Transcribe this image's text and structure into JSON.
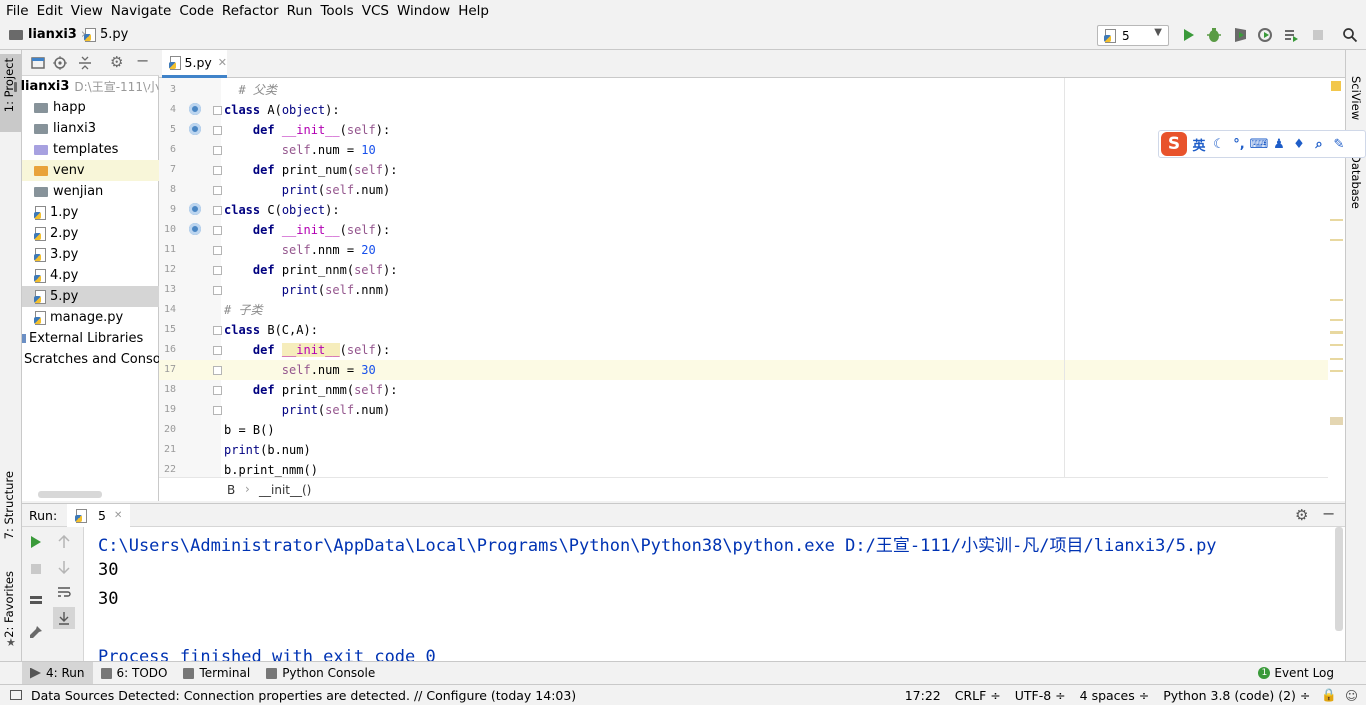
{
  "menu": [
    "File",
    "Edit",
    "View",
    "Navigate",
    "Code",
    "Refactor",
    "Run",
    "Tools",
    "VCS",
    "Window",
    "Help"
  ],
  "nav": {
    "project": "lianxi3",
    "file": "5.py"
  },
  "run_config": {
    "selected": "5"
  },
  "left_tabs": {
    "project": "1: Project",
    "structure": "7: Structure",
    "favorites": "2: Favorites"
  },
  "right_tabs": {
    "sciview": "SciView",
    "database": "Database"
  },
  "project_tree": {
    "root_name": "lianxi3",
    "root_path": "D:\\王宣-111\\小",
    "items": [
      {
        "label": "happ",
        "kind": "folder"
      },
      {
        "label": "lianxi3",
        "kind": "folder"
      },
      {
        "label": "templates",
        "kind": "folder-purple"
      },
      {
        "label": "venv",
        "kind": "folder-orange"
      },
      {
        "label": "wenjian",
        "kind": "folder"
      },
      {
        "label": "1.py",
        "kind": "py"
      },
      {
        "label": "2.py",
        "kind": "py"
      },
      {
        "label": "3.py",
        "kind": "py"
      },
      {
        "label": "4.py",
        "kind": "py"
      },
      {
        "label": "5.py",
        "kind": "py",
        "selected": true
      },
      {
        "label": "manage.py",
        "kind": "py"
      }
    ],
    "external": "External Libraries",
    "scratches": "Scratches and Console"
  },
  "editor": {
    "tab_label": "5.py",
    "current_line": 17,
    "lines": [
      {
        "n": 3,
        "html": "  <span class=\"cmt\"># 父类</span>"
      },
      {
        "n": 4,
        "html": "<span class=\"kw\">class</span> A(<span class=\"bi\">object</span>):"
      },
      {
        "n": 5,
        "html": "    <span class=\"kw\">def</span> <span class=\"dunder\">__init__</span>(<span class=\"slf\">self</span>):"
      },
      {
        "n": 6,
        "html": "        <span class=\"slf\">self</span>.num = <span class=\"num\">10</span>"
      },
      {
        "n": 7,
        "html": "    <span class=\"kw\">def</span> print_num(<span class=\"slf\">self</span>):"
      },
      {
        "n": 8,
        "html": "        <span class=\"bi\">print</span>(<span class=\"slf\">self</span>.num)"
      },
      {
        "n": 9,
        "html": "<span class=\"kw\">class</span> C(<span class=\"bi\">object</span>):"
      },
      {
        "n": 10,
        "html": "    <span class=\"kw\">def</span> <span class=\"dunder\">__init__</span>(<span class=\"slf\">self</span>):"
      },
      {
        "n": 11,
        "html": "        <span class=\"slf\">self</span>.nnm = <span class=\"num\">20</span>"
      },
      {
        "n": 12,
        "html": "    <span class=\"kw\">def</span> print_nnm(<span class=\"slf\">self</span>):"
      },
      {
        "n": 13,
        "html": "        <span class=\"bi\">print</span>(<span class=\"slf\">self</span>.nnm)"
      },
      {
        "n": 14,
        "html": "<span class=\"cmt\"># 子类</span>"
      },
      {
        "n": 15,
        "html": "<span class=\"kw\">class</span> B(C,A):"
      },
      {
        "n": 16,
        "html": "    <span class=\"kw\">def</span> <span class=\"dunder hl\">__init__</span>(<span class=\"slf\">self</span>):"
      },
      {
        "n": 17,
        "html": "        <span class=\"slf\">self</span>.num = <span class=\"num\">30</span>"
      },
      {
        "n": 18,
        "html": "    <span class=\"kw\">def</span> print_nmm(<span class=\"slf\">self</span>):"
      },
      {
        "n": 19,
        "html": "        <span class=\"bi\">print</span>(<span class=\"slf\">self</span>.num)"
      },
      {
        "n": 20,
        "html": "b = B()"
      },
      {
        "n": 21,
        "html": "<span class=\"bi\">print</span>(b.num)"
      },
      {
        "n": 22,
        "html": "b.print_nmm()"
      }
    ],
    "breadcrumb": [
      "B",
      "__init__()"
    ]
  },
  "run_panel": {
    "label": "Run:",
    "tab": "5",
    "output": [
      "C:\\Users\\Administrator\\AppData\\Local\\Programs\\Python\\Python38\\python.exe D:/王宣-111/小实训-凡/项目/lianxi3/5.py",
      "30",
      "30",
      "",
      "Process finished with exit code 0"
    ]
  },
  "bottom_tabs": [
    {
      "label": "4: Run",
      "icon": "run-icon",
      "active": true
    },
    {
      "label": "6: TODO",
      "icon": "todo-icon"
    },
    {
      "label": "Terminal",
      "icon": "terminal-icon"
    },
    {
      "label": "Python Console",
      "icon": "python-console-icon"
    }
  ],
  "event_log": "Event Log",
  "event_log_badge": "1",
  "status": {
    "message": "Data Sources Detected: Connection properties are detected. // Configure (today 14:03)",
    "position": "17:22",
    "line_sep": "CRLF ÷",
    "encoding": "UTF-8 ÷",
    "indent": "4 spaces ÷",
    "interpreter": "Python 3.8 (code) (2) ÷"
  },
  "ime": {
    "label": "英"
  },
  "colors": {
    "keyword": "#000080",
    "self": "#94558d",
    "number": "#1750eb",
    "comment": "#8c8c8c",
    "dunder": "#b200b2",
    "accent": "#4083c9"
  }
}
